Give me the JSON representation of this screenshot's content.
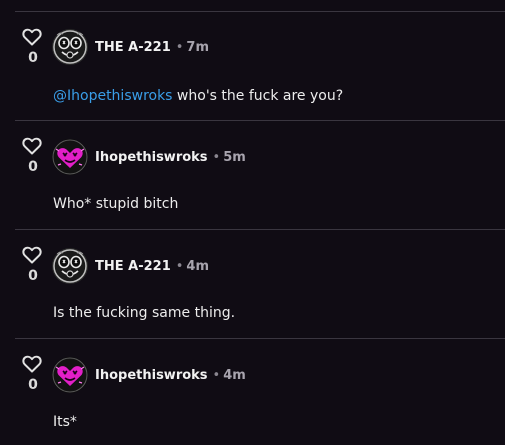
{
  "comments": [
    {
      "username": "THE A-221",
      "timestamp": "7m",
      "likes": "0",
      "mention": "@Ihopethiswroks",
      "text": " who's the fuck are you?",
      "avatar": "gasmask-avatar"
    },
    {
      "username": "Ihopethiswroks",
      "timestamp": "5m",
      "likes": "0",
      "mention": "",
      "text": "Who* stupid bitch",
      "avatar": "pink-heart-avatar"
    },
    {
      "username": "THE A-221",
      "timestamp": "4m",
      "likes": "0",
      "mention": "",
      "text": "Is the fucking same thing.",
      "avatar": "gasmask-avatar"
    },
    {
      "username": "Ihopethiswroks",
      "timestamp": "4m",
      "likes": "0",
      "mention": "",
      "text": "Its*",
      "avatar": "pink-heart-avatar"
    }
  ],
  "separator": "•",
  "colors": {
    "background": "#100c14",
    "divider": "#3a3640",
    "mention": "#3a9ee8",
    "accent_pink": "#e21fc8"
  }
}
